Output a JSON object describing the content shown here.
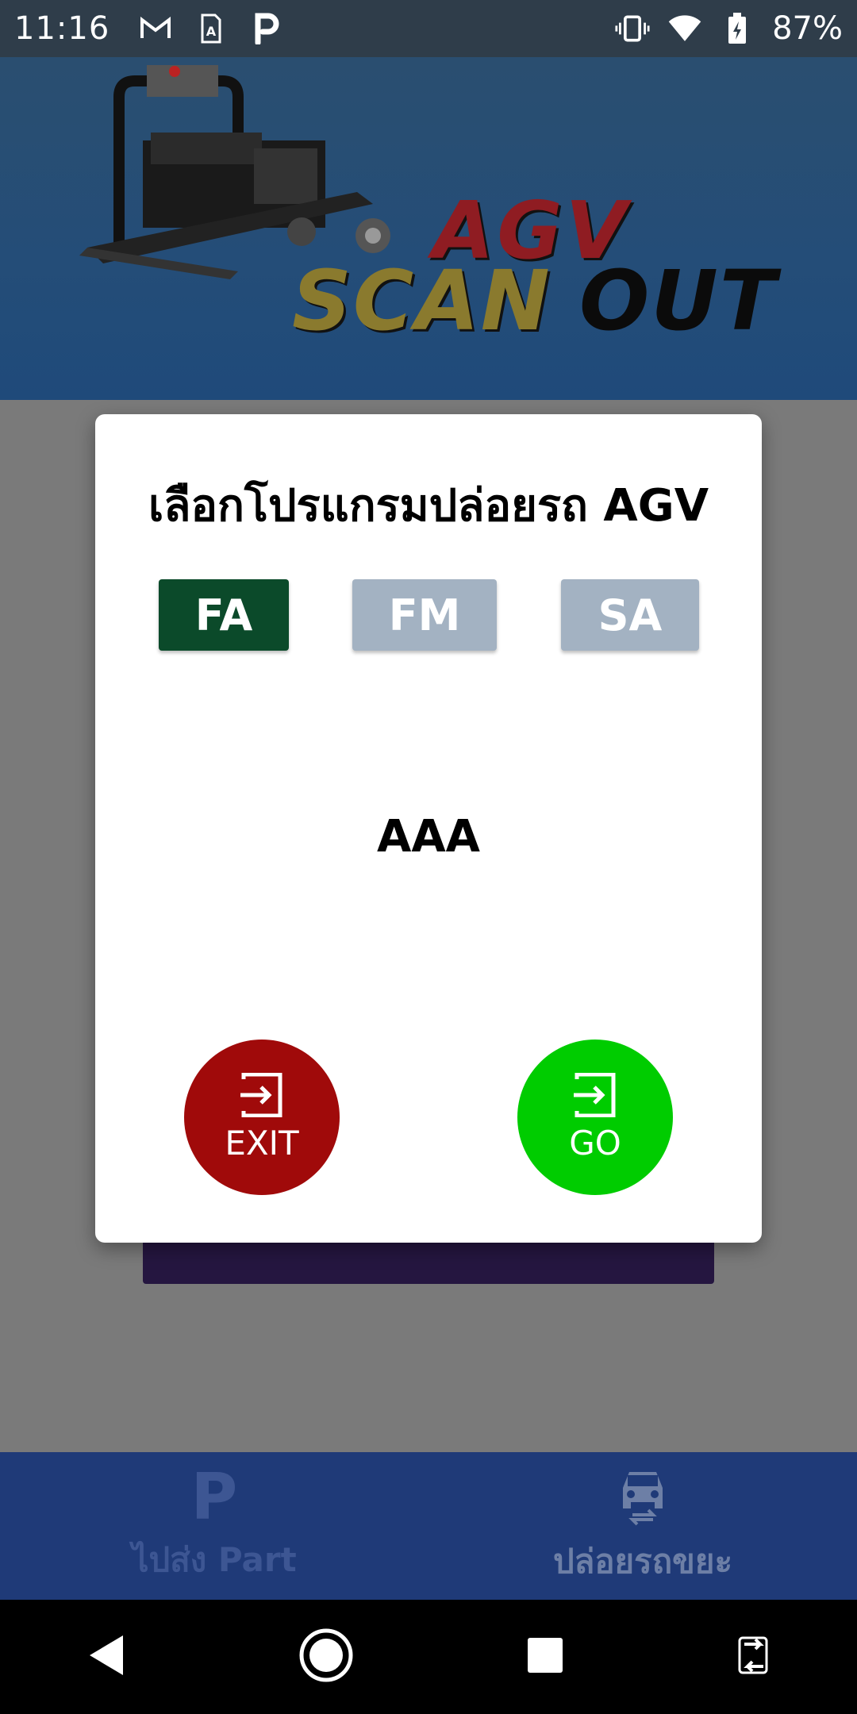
{
  "status_bar": {
    "time": "11:16",
    "battery": "87%",
    "left_icons": [
      "gmail-icon",
      "sim-icon",
      "parking-app-icon"
    ],
    "right_icons": [
      "vibrate-icon",
      "wifi-icon",
      "battery-charging-icon"
    ]
  },
  "banner": {
    "line1": "AGV",
    "line2_a": "SCAN",
    "line2_b": "OUT"
  },
  "dialog": {
    "title": "เลือกโปรแกรมปล่อยรถ AGV",
    "programs": [
      {
        "label": "FA",
        "selected": true,
        "color": "#0b4a2a"
      },
      {
        "label": "FM",
        "selected": false,
        "color": "#a3b2c2"
      },
      {
        "label": "SA",
        "selected": false,
        "color": "#a3b2c2"
      }
    ],
    "selected_value": "AAA",
    "exit_label": "EXIT",
    "go_label": "GO",
    "exit_color": "#a00a0a",
    "go_color": "#00cc00"
  },
  "bottom_nav": {
    "items": [
      {
        "label": "ไปส่ง Part",
        "icon": "parking-icon",
        "active": false
      },
      {
        "label": "ปล่อยรถขยะ",
        "icon": "car-swap-icon",
        "active": true
      }
    ]
  }
}
